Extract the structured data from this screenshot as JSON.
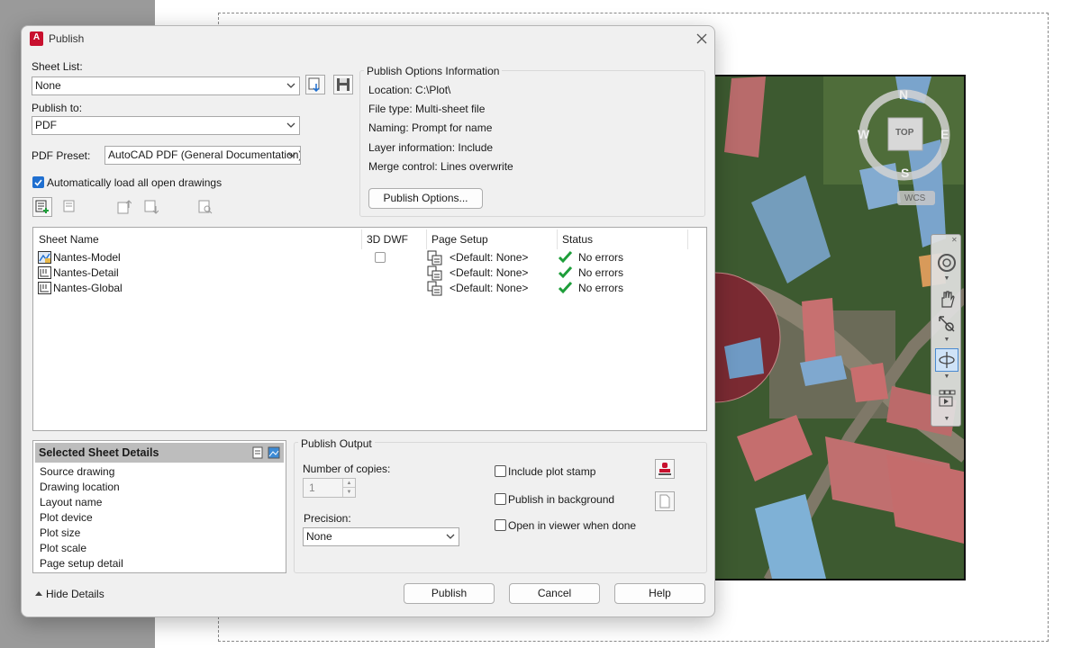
{
  "dialog": {
    "title": "Publish",
    "app_icon_letter": "A",
    "sheet_list": {
      "label": "Sheet List:",
      "value": "None"
    },
    "publish_to": {
      "label": "Publish to:",
      "value": "PDF"
    },
    "pdf_preset": {
      "label": "PDF Preset:",
      "value": "AutoCAD PDF (General Documentation)"
    },
    "auto_load": {
      "label": "Automatically load all open drawings",
      "checked": true
    },
    "options_info": {
      "title": "Publish Options Information",
      "location": "Location:  C:\\Plot\\",
      "file_type": "File type:  Multi-sheet file",
      "naming": "Naming:  Prompt for name",
      "layer_info": "Layer information:  Include",
      "merge_control": "Merge control:  Lines overwrite",
      "options_button": "Publish Options..."
    },
    "sheet_table": {
      "columns": [
        "Sheet Name",
        "3D DWF",
        "Page Setup",
        "Status"
      ],
      "rows": [
        {
          "name": "Nantes-Model",
          "page_setup": "<Default: None>",
          "status": "No errors",
          "icon": "model-icon",
          "has_3d_checkbox": true
        },
        {
          "name": "Nantes-Detail",
          "page_setup": "<Default: None>",
          "status": "No errors",
          "icon": "layout-icon",
          "has_3d_checkbox": false
        },
        {
          "name": "Nantes-Global",
          "page_setup": "<Default: None>",
          "status": "No errors",
          "icon": "layout-icon",
          "has_3d_checkbox": false
        }
      ]
    },
    "selected_sheet_details": {
      "title": "Selected Sheet Details",
      "items": [
        "Source drawing",
        "Drawing location",
        "Layout name",
        "Plot device",
        "Plot size",
        "Plot scale",
        "Page setup detail"
      ]
    },
    "publish_output": {
      "title": "Publish Output",
      "copies_label": "Number of copies:",
      "copies_value": "1",
      "precision_label": "Precision:",
      "precision_value": "None",
      "include_plot_stamp": "Include plot stamp",
      "publish_in_background": "Publish in background",
      "open_in_viewer": "Open in viewer when done"
    },
    "footer": {
      "hide_details": "Hide Details",
      "publish": "Publish",
      "cancel": "Cancel",
      "help": "Help"
    }
  },
  "viewcube": {
    "north": "N",
    "south": "S",
    "east": "E",
    "west": "W",
    "top": "TOP",
    "wcs": "WCS"
  },
  "colors": {
    "accent": "#1f6fd0",
    "status_ok": "#1e9e3a",
    "title_icon": "#c8102e"
  }
}
